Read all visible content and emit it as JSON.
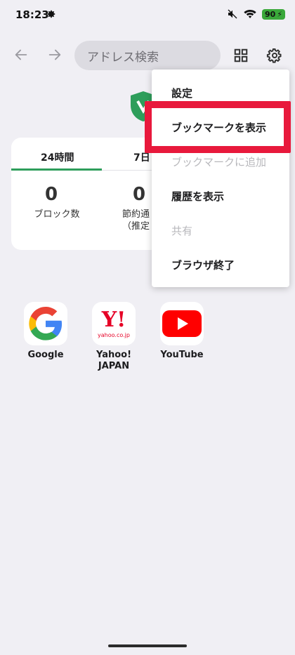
{
  "status_bar": {
    "time": "18:23",
    "battery": "90"
  },
  "toolbar": {
    "address_placeholder": "アドレス検索"
  },
  "stats_card": {
    "tabs": [
      {
        "label": "24時間"
      },
      {
        "label": "7日"
      }
    ],
    "stats": [
      {
        "value": "0",
        "label": "ブロック数"
      },
      {
        "value": "0",
        "label_line1": "節約通",
        "label_line2": "（推定"
      }
    ]
  },
  "shortcuts": [
    {
      "label_line1": "Google",
      "label_line2": ""
    },
    {
      "label_line1": "Yahoo!",
      "label_line2": "JAPAN",
      "logo_text": "Y!",
      "logo_sub": "yahoo.co.jp"
    },
    {
      "label_line1": "YouTube",
      "label_line2": ""
    }
  ],
  "menu": {
    "items": [
      {
        "label": "設定",
        "enabled": true
      },
      {
        "label": "ブックマークを表示",
        "enabled": true,
        "highlighted": true
      },
      {
        "label": "ブックマークに追加",
        "enabled": false
      },
      {
        "label": "履歴を表示",
        "enabled": true
      },
      {
        "label": "共有",
        "enabled": false
      },
      {
        "label": "ブラウザ終了",
        "enabled": true
      }
    ]
  },
  "colors": {
    "accent": "#2e9e5b",
    "highlight": "#e8193c",
    "youtube_red": "#ff0000",
    "yahoo_red": "#e60026"
  }
}
